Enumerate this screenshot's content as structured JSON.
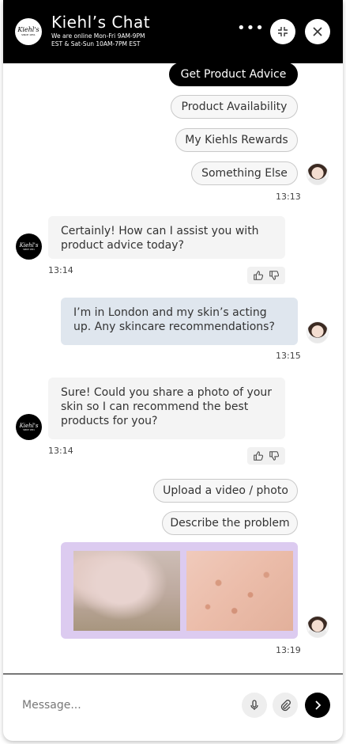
{
  "header": {
    "logo_text": "Kiehl's",
    "logo_sub": "SINCE 1851",
    "title": "Kiehl’s Chat",
    "hours_line1": "We are online Mon-Fri 9AM-9PM",
    "hours_line2": "EST & Sat-Sun 10AM-7PM EST",
    "more_label": "•••"
  },
  "quick_replies": {
    "options": [
      "Get Product Advice",
      "Product Availability",
      "My Kiehls Rewards",
      "Something Else"
    ],
    "time": "13:13"
  },
  "messages": [
    {
      "from": "bot",
      "text": "Certainly! How can I assist you with product advice today?",
      "time": "13:14"
    },
    {
      "from": "user",
      "text": "I’m in London and my skin’s acting up. Any skincare recommendations?",
      "time": "13:15"
    },
    {
      "from": "bot",
      "text": "Sure! Could you share a photo of your skin so I can recommend the best products for you?",
      "time": "13:14"
    }
  ],
  "photo_options": {
    "upload": "Upload a video / photo",
    "describe": "Describe the problem"
  },
  "media_time": "13:19",
  "composer": {
    "placeholder": "Message..."
  },
  "colors": {
    "header_bg": "#000000",
    "user_bubble": "#dfe6ee",
    "bot_bubble": "#f4f4f4",
    "media_bg": "#dccbf0"
  }
}
